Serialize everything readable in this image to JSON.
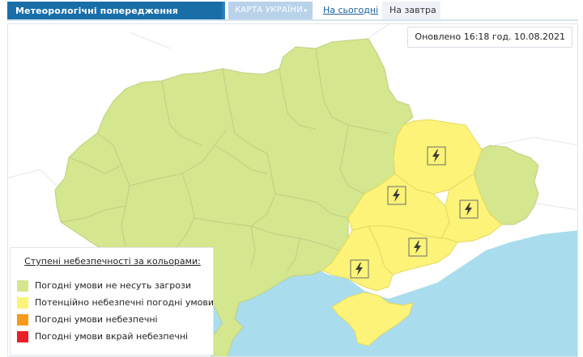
{
  "header": {
    "title": "Метеорологічні попередження",
    "tabs": [
      {
        "label": "КАРТА УКРАЇНИ",
        "arrow": "▸"
      },
      {
        "label": "На сьогодні"
      },
      {
        "label": "На завтра"
      }
    ]
  },
  "map": {
    "updated": "Оновлено 16:18 год. 10.08.2021",
    "colors": {
      "green": "#d4e68e",
      "yellow": "#fcf378",
      "orange": "#f7991c",
      "red": "#e8202a",
      "sea": "#a9dcec",
      "neighbor": "#ffffff",
      "border": "#b9c98a"
    },
    "alert_icon": "lightning-icon"
  },
  "legend": {
    "title": "Ступені небезпечності за кольорами:",
    "items": [
      {
        "label": "Погодні умови не несуть загрози",
        "color": "#d4e68e"
      },
      {
        "label": "Потенційно небезпечні погодні умови",
        "color": "#fcf378"
      },
      {
        "label": "Погодні умови небезпечні",
        "color": "#f7991c"
      },
      {
        "label": "Погодні умови вкрай небезпечні",
        "color": "#e8202a"
      }
    ]
  }
}
